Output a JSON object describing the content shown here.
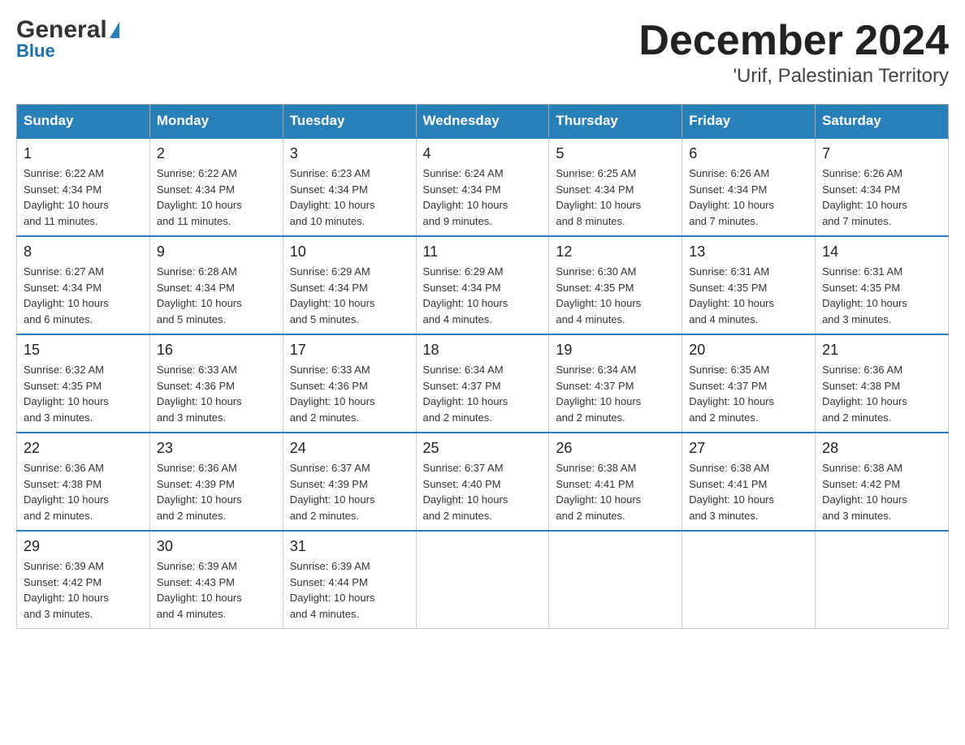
{
  "header": {
    "logo": {
      "general": "General",
      "blue": "Blue"
    },
    "month": "December 2024",
    "location": "'Urif, Palestinian Territory"
  },
  "weekdays": [
    "Sunday",
    "Monday",
    "Tuesday",
    "Wednesday",
    "Thursday",
    "Friday",
    "Saturday"
  ],
  "weeks": [
    [
      {
        "day": "1",
        "sunrise": "6:22 AM",
        "sunset": "4:34 PM",
        "daylight": "10 hours and 11 minutes."
      },
      {
        "day": "2",
        "sunrise": "6:22 AM",
        "sunset": "4:34 PM",
        "daylight": "10 hours and 11 minutes."
      },
      {
        "day": "3",
        "sunrise": "6:23 AM",
        "sunset": "4:34 PM",
        "daylight": "10 hours and 10 minutes."
      },
      {
        "day": "4",
        "sunrise": "6:24 AM",
        "sunset": "4:34 PM",
        "daylight": "10 hours and 9 minutes."
      },
      {
        "day": "5",
        "sunrise": "6:25 AM",
        "sunset": "4:34 PM",
        "daylight": "10 hours and 8 minutes."
      },
      {
        "day": "6",
        "sunrise": "6:26 AM",
        "sunset": "4:34 PM",
        "daylight": "10 hours and 7 minutes."
      },
      {
        "day": "7",
        "sunrise": "6:26 AM",
        "sunset": "4:34 PM",
        "daylight": "10 hours and 7 minutes."
      }
    ],
    [
      {
        "day": "8",
        "sunrise": "6:27 AM",
        "sunset": "4:34 PM",
        "daylight": "10 hours and 6 minutes."
      },
      {
        "day": "9",
        "sunrise": "6:28 AM",
        "sunset": "4:34 PM",
        "daylight": "10 hours and 5 minutes."
      },
      {
        "day": "10",
        "sunrise": "6:29 AM",
        "sunset": "4:34 PM",
        "daylight": "10 hours and 5 minutes."
      },
      {
        "day": "11",
        "sunrise": "6:29 AM",
        "sunset": "4:34 PM",
        "daylight": "10 hours and 4 minutes."
      },
      {
        "day": "12",
        "sunrise": "6:30 AM",
        "sunset": "4:35 PM",
        "daylight": "10 hours and 4 minutes."
      },
      {
        "day": "13",
        "sunrise": "6:31 AM",
        "sunset": "4:35 PM",
        "daylight": "10 hours and 4 minutes."
      },
      {
        "day": "14",
        "sunrise": "6:31 AM",
        "sunset": "4:35 PM",
        "daylight": "10 hours and 3 minutes."
      }
    ],
    [
      {
        "day": "15",
        "sunrise": "6:32 AM",
        "sunset": "4:35 PM",
        "daylight": "10 hours and 3 minutes."
      },
      {
        "day": "16",
        "sunrise": "6:33 AM",
        "sunset": "4:36 PM",
        "daylight": "10 hours and 3 minutes."
      },
      {
        "day": "17",
        "sunrise": "6:33 AM",
        "sunset": "4:36 PM",
        "daylight": "10 hours and 2 minutes."
      },
      {
        "day": "18",
        "sunrise": "6:34 AM",
        "sunset": "4:37 PM",
        "daylight": "10 hours and 2 minutes."
      },
      {
        "day": "19",
        "sunrise": "6:34 AM",
        "sunset": "4:37 PM",
        "daylight": "10 hours and 2 minutes."
      },
      {
        "day": "20",
        "sunrise": "6:35 AM",
        "sunset": "4:37 PM",
        "daylight": "10 hours and 2 minutes."
      },
      {
        "day": "21",
        "sunrise": "6:36 AM",
        "sunset": "4:38 PM",
        "daylight": "10 hours and 2 minutes."
      }
    ],
    [
      {
        "day": "22",
        "sunrise": "6:36 AM",
        "sunset": "4:38 PM",
        "daylight": "10 hours and 2 minutes."
      },
      {
        "day": "23",
        "sunrise": "6:36 AM",
        "sunset": "4:39 PM",
        "daylight": "10 hours and 2 minutes."
      },
      {
        "day": "24",
        "sunrise": "6:37 AM",
        "sunset": "4:39 PM",
        "daylight": "10 hours and 2 minutes."
      },
      {
        "day": "25",
        "sunrise": "6:37 AM",
        "sunset": "4:40 PM",
        "daylight": "10 hours and 2 minutes."
      },
      {
        "day": "26",
        "sunrise": "6:38 AM",
        "sunset": "4:41 PM",
        "daylight": "10 hours and 2 minutes."
      },
      {
        "day": "27",
        "sunrise": "6:38 AM",
        "sunset": "4:41 PM",
        "daylight": "10 hours and 3 minutes."
      },
      {
        "day": "28",
        "sunrise": "6:38 AM",
        "sunset": "4:42 PM",
        "daylight": "10 hours and 3 minutes."
      }
    ],
    [
      {
        "day": "29",
        "sunrise": "6:39 AM",
        "sunset": "4:42 PM",
        "daylight": "10 hours and 3 minutes."
      },
      {
        "day": "30",
        "sunrise": "6:39 AM",
        "sunset": "4:43 PM",
        "daylight": "10 hours and 4 minutes."
      },
      {
        "day": "31",
        "sunrise": "6:39 AM",
        "sunset": "4:44 PM",
        "daylight": "10 hours and 4 minutes."
      },
      null,
      null,
      null,
      null
    ]
  ],
  "labels": {
    "sunrise": "Sunrise:",
    "sunset": "Sunset:",
    "daylight": "Daylight:"
  }
}
